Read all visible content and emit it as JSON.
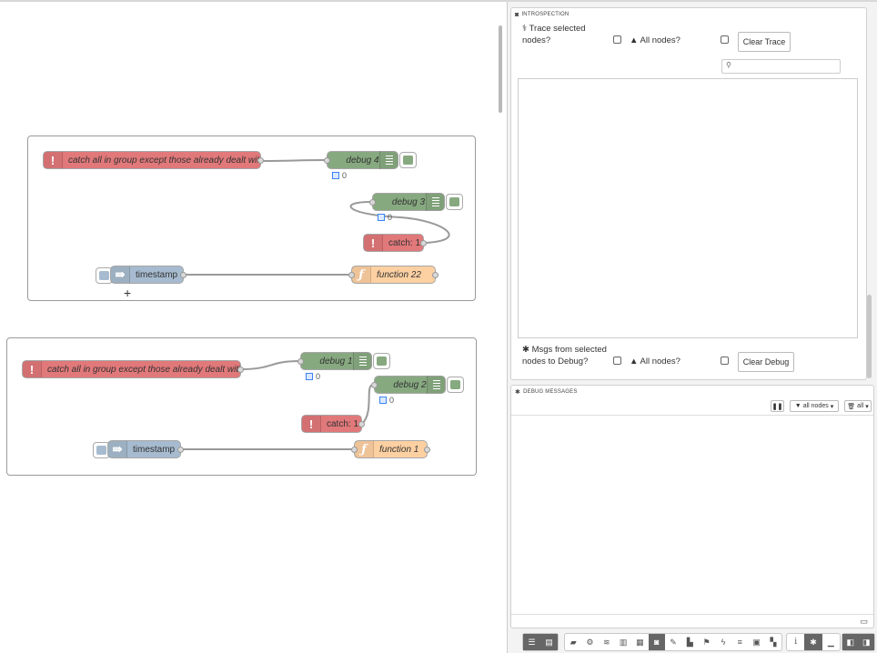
{
  "workspace": {
    "group1": {
      "catch_all_label": "catch all in group except those already dealt with",
      "debug4_label": "debug 4",
      "debug4_status": "0",
      "debug3_label": "debug 3",
      "debug3_status": "0",
      "catch1_label": "catch: 1",
      "inject_label": "timestamp",
      "function_label": "function 22"
    },
    "group2": {
      "catch_all_label": "catch all in group except those already dealt with",
      "debug1_label": "debug 1",
      "debug1_status": "0",
      "debug2_label": "debug 2",
      "debug2_status": "0",
      "catch1_label": "catch: 1",
      "inject_label": "timestamp",
      "function_label": "function 1"
    }
  },
  "introspection": {
    "title": "INTROSPECTION",
    "trace_label_line1": "Trace selected",
    "trace_label_line2": "nodes?",
    "all_nodes_label": "All nodes?",
    "clear_trace_label": "Clear Trace",
    "msgs_label_line1": "Msgs from selected",
    "msgs_label_line2": "nodes to Debug?",
    "all_nodes_label2": "All nodes?",
    "clear_debug_label": "Clear Debug"
  },
  "debug_messages": {
    "title": "DEBUG MESSAGES",
    "filter_label": "all nodes",
    "clear_label": "all"
  },
  "colors": {
    "catch": "#e1787a",
    "debug": "#87a980",
    "function": "#fdd0a2",
    "inject": "#a6bbcf"
  },
  "toolbar_icons": [
    "list-icon",
    "doc-icon",
    "book-icon",
    "gear-icon",
    "database-icon",
    "chart-icon",
    "grid-icon",
    "camera-icon",
    "edit-icon",
    "bar-chart-icon",
    "flag-icon",
    "bolt-icon",
    "list2-icon",
    "id-card-icon",
    "map-icon",
    "info-icon",
    "bug-icon",
    "minus-icon",
    "sidebar-left-icon",
    "sidebar-right-icon"
  ]
}
